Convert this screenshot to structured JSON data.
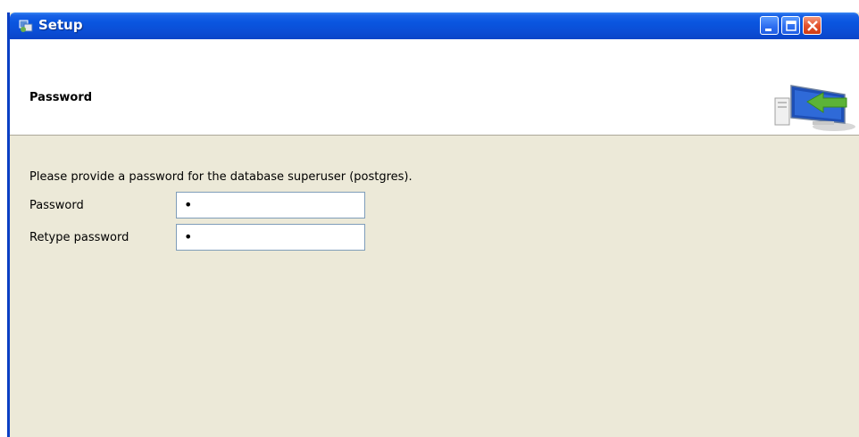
{
  "window": {
    "title": "Setup",
    "icon": "setup-app-icon",
    "controls": [
      "minimize-icon",
      "maximize-icon",
      "close-icon"
    ]
  },
  "header": {
    "title": "Password",
    "graphic": "computer-install-arrow-icon"
  },
  "body": {
    "instructions": "Please provide a password for the database superuser (postgres).",
    "fields": [
      {
        "label": "Password",
        "value": "•"
      },
      {
        "label": "Retype password",
        "value": "•"
      }
    ]
  },
  "colors": {
    "titlebar": "#0a56e0",
    "dialog_bg": "#ece9d8",
    "input_border": "#7f9db9",
    "close_button": "#e4532f"
  }
}
